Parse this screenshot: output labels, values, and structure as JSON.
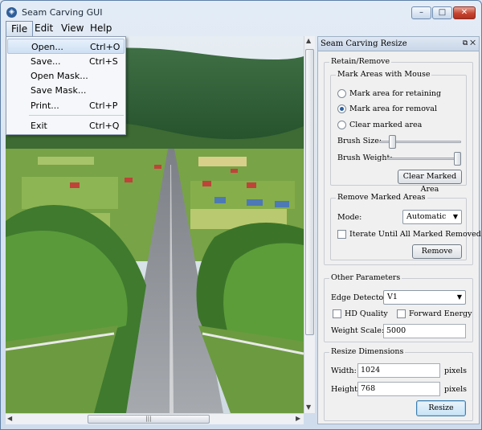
{
  "window": {
    "title": "Seam Carving GUI",
    "controls": {
      "minimize": "–",
      "maximize": "□",
      "close": "✕"
    }
  },
  "menubar": {
    "items": [
      "File",
      "Edit",
      "View",
      "Help"
    ],
    "active": "File"
  },
  "file_menu": {
    "items": [
      {
        "label": "Open...",
        "shortcut": "Ctrl+O"
      },
      {
        "label": "Save...",
        "shortcut": "Ctrl+S"
      },
      {
        "label": "Open Mask...",
        "shortcut": ""
      },
      {
        "label": "Save Mask...",
        "shortcut": ""
      },
      {
        "label": "Print...",
        "shortcut": "Ctrl+P"
      },
      {
        "label": "Exit",
        "shortcut": "Ctrl+Q"
      }
    ]
  },
  "panel": {
    "title": "Seam Carving Resize",
    "header_icons": "⧉ ✕",
    "retain_remove": {
      "label": "Retain/Remove",
      "mark_areas": {
        "label": "Mark Areas with Mouse",
        "options": [
          "Mark area for retaining",
          "Mark area for removal",
          "Clear marked area"
        ],
        "selected_index": 1,
        "brush_size_label": "Brush Size:",
        "brush_size_level": 0.05,
        "brush_weight_label": "Brush Weight:",
        "brush_weight_level": 1.0,
        "clear_button": "Clear Marked Area"
      },
      "remove_marked": {
        "label": "Remove Marked Areas",
        "mode_label": "Mode:",
        "mode_value": "Automatic",
        "iterate_label": "Iterate Until All Marked Removed",
        "iterate_checked": false,
        "remove_button": "Remove"
      }
    },
    "other_params": {
      "label": "Other Parameters",
      "edge_detector_label": "Edge Detector:",
      "edge_detector_value": "V1",
      "hd_quality_label": "HD Quality",
      "hd_quality_checked": false,
      "forward_energy_label": "Forward Energy",
      "forward_energy_checked": false,
      "weight_scale_label": "Weight Scale:",
      "weight_scale_value": "5000"
    },
    "resize": {
      "label": "Resize Dimensions",
      "width_label": "Width:",
      "width_value": "1024",
      "width_unit": "pixels",
      "height_label": "Height:",
      "height_value": "768",
      "height_unit": "pixels",
      "resize_button": "Resize"
    }
  },
  "scrollbars": {
    "thumb_grip": "|||"
  },
  "colors": {
    "sky": "#dfe7ee",
    "hills": "#2e5a2a",
    "field": "#6f9a3e",
    "road": "#8d9196",
    "accent": "#3c7fb1"
  }
}
